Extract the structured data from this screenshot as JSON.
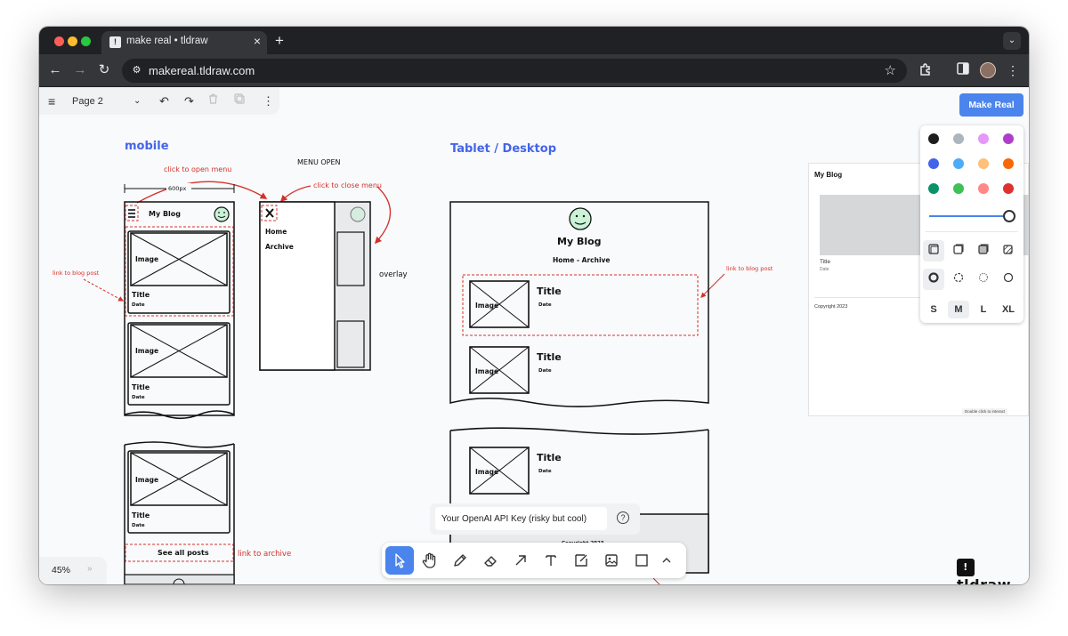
{
  "browser": {
    "tab_title": "make real • tldraw",
    "url": "makereal.tldraw.com",
    "favicon_letter": "!",
    "traffic_colors": [
      "#ff5f57",
      "#febc2e",
      "#28c840"
    ]
  },
  "menu": {
    "page_label": "Page 2",
    "icons": [
      "hamburger-icon",
      "chevron-down-icon",
      "undo-icon",
      "redo-icon",
      "trash-icon",
      "duplicate-icon",
      "more-icon"
    ]
  },
  "actions": {
    "make_real": "Make Real"
  },
  "style_panel": {
    "colors": [
      "#1d1d1d",
      "#adb5bd",
      "#e599f7",
      "#ae3ec9",
      "#4263eb",
      "#4dabf7",
      "#ffc078",
      "#f76707",
      "#099268",
      "#40c057",
      "#ff8787",
      "#e03131"
    ],
    "opacity": 1,
    "sizes": [
      "S",
      "M",
      "L",
      "XL"
    ],
    "selected_size": "M"
  },
  "canvas": {
    "mobile_heading": "mobile",
    "tablet_heading": "Tablet / Desktop",
    "menu_open_label": "MENU OPEN",
    "click_open_menu": "click to open menu",
    "click_close_menu": "click to close menu",
    "width_label": "600px",
    "link_blog_post": "link to blog post",
    "link_archive": "link to archive",
    "overlay": "overlay",
    "blog_title": "My Blog",
    "nav_text": "Home - Archive",
    "menu_home": "Home",
    "menu_archive": "Archive",
    "image": "Image",
    "title": "Title",
    "date": "Date",
    "see_all": "See all posts",
    "copyright": "Copyright 2023"
  },
  "preview": {
    "title": "My Blog",
    "post_title": "Title",
    "post_date": "Date",
    "copyright": "Copyright 2023",
    "hint": "Double click to interact"
  },
  "zoom": {
    "level": "45%",
    "more": "»"
  },
  "api_key": {
    "placeholder": "Your OpenAI API Key (risky but cool)",
    "value": ""
  },
  "tools": [
    "select-tool",
    "hand-tool",
    "draw-tool",
    "eraser-tool",
    "arrow-tool",
    "text-tool",
    "note-tool",
    "media-tool",
    "rectangle-tool",
    "more-tools"
  ],
  "brand": {
    "wordmark": "tldraw"
  }
}
